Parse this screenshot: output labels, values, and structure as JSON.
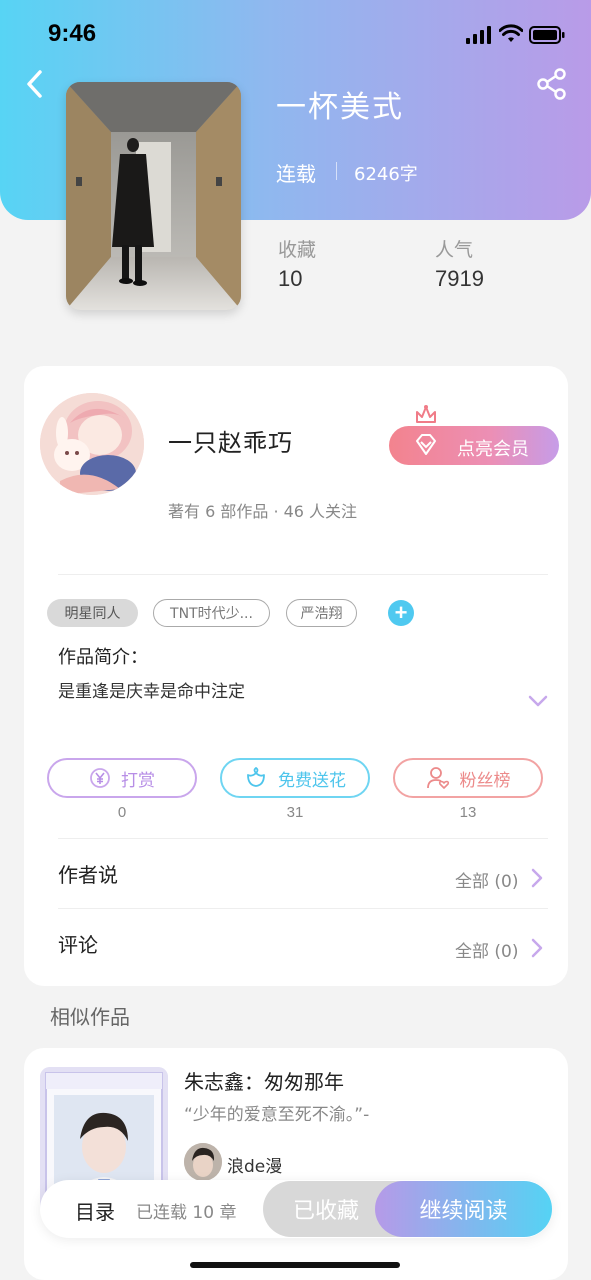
{
  "status_bar": {
    "time": "9:46"
  },
  "book": {
    "title": "一杯美式",
    "status": "连载",
    "word_count": "6246字",
    "stats": [
      {
        "label": "收藏",
        "value": "10"
      },
      {
        "label": "人气",
        "value": "7919"
      }
    ]
  },
  "author": {
    "name": "一只赵乖巧",
    "meta": "著有 6 部作品 · 46 人关注",
    "vip_button": "点亮会员"
  },
  "tags": [
    "明星同人",
    "TNT时代少...",
    "严浩翔"
  ],
  "intro": {
    "label": "作品简介：",
    "text": "是重逢是庆幸是命中注定"
  },
  "actions": [
    {
      "label": "打赏",
      "count": "0",
      "icon": "yen-coin-icon"
    },
    {
      "label": "免费送花",
      "count": "31",
      "icon": "flower-icon"
    },
    {
      "label": "粉丝榜",
      "count": "13",
      "icon": "fans-heart-icon"
    }
  ],
  "rows": [
    {
      "label": "作者说",
      "right": "全部 (0)"
    },
    {
      "label": "评论",
      "right": "全部 (0)"
    }
  ],
  "similar": {
    "section_title": "相似作品",
    "title": "朱志鑫：匆匆那年",
    "quote": "“少年的爱意至死不渝。”-",
    "author": "浪de漫"
  },
  "bottom_bar": {
    "toc": "目录",
    "chapters": "已连载 10 章",
    "collected": "已收藏",
    "continue": "继续阅读"
  },
  "colors": {
    "header_gradient_start": "#57d4f4",
    "header_gradient_end": "#b99be8",
    "accent_blue": "#4fc9f0",
    "accent_purple": "#b69ae8",
    "vip_pink": "#f3838e"
  }
}
